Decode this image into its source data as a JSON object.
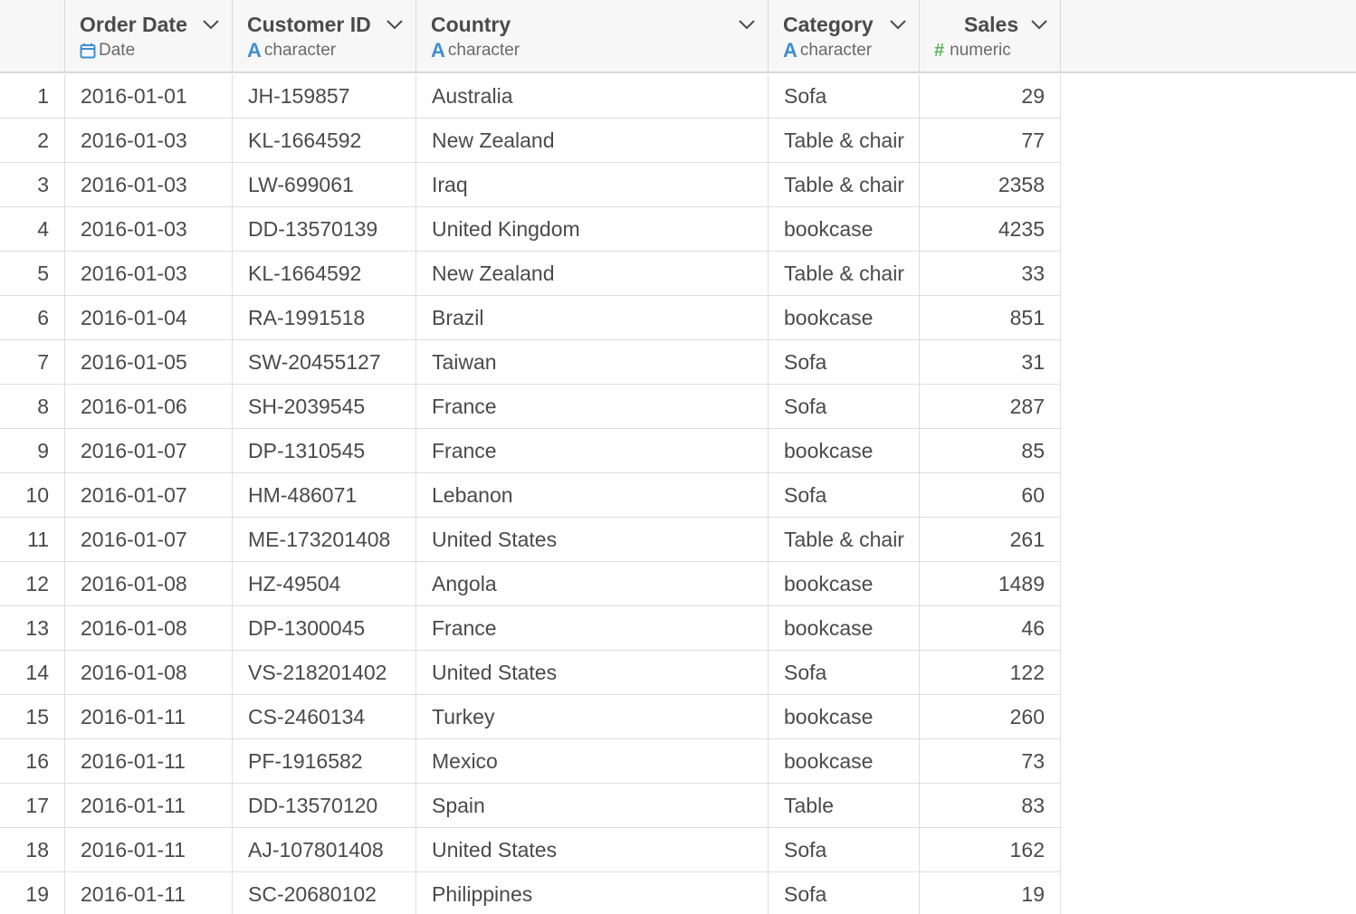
{
  "columns": [
    {
      "name": "Order Date",
      "type_label": "Date",
      "type_icon": "calendar-icon"
    },
    {
      "name": "Customer ID",
      "type_label": "character",
      "type_icon": "character-type-icon",
      "type_glyph": "A"
    },
    {
      "name": "Country",
      "type_label": "character",
      "type_icon": "character-type-icon",
      "type_glyph": "A"
    },
    {
      "name": "Category",
      "type_label": "character",
      "type_icon": "character-type-icon",
      "type_glyph": "A"
    },
    {
      "name": "Sales",
      "type_label": "numeric",
      "type_icon": "numeric-type-icon",
      "type_glyph": "#"
    }
  ],
  "colors": {
    "header_bg": "#f7f7f7",
    "grid_line": "#dedede",
    "text": "#4a4a4a",
    "character_icon": "#3d8fd1",
    "numeric_icon": "#5fb35f",
    "date_icon": "#3d8fd1"
  },
  "rows": [
    {
      "n": "1",
      "order_date": "2016-01-01",
      "customer_id": "JH-159857",
      "country": "Australia",
      "category": "Sofa",
      "sales": "29"
    },
    {
      "n": "2",
      "order_date": "2016-01-03",
      "customer_id": "KL-1664592",
      "country": "New Zealand",
      "category": "Table & chair",
      "sales": "77"
    },
    {
      "n": "3",
      "order_date": "2016-01-03",
      "customer_id": "LW-699061",
      "country": "Iraq",
      "category": "Table & chair",
      "sales": "2358"
    },
    {
      "n": "4",
      "order_date": "2016-01-03",
      "customer_id": "DD-13570139",
      "country": "United Kingdom",
      "category": "bookcase",
      "sales": "4235"
    },
    {
      "n": "5",
      "order_date": "2016-01-03",
      "customer_id": "KL-1664592",
      "country": "New Zealand",
      "category": "Table & chair",
      "sales": "33"
    },
    {
      "n": "6",
      "order_date": "2016-01-04",
      "customer_id": "RA-1991518",
      "country": "Brazil",
      "category": "bookcase",
      "sales": "851"
    },
    {
      "n": "7",
      "order_date": "2016-01-05",
      "customer_id": "SW-20455127",
      "country": "Taiwan",
      "category": "Sofa",
      "sales": "31"
    },
    {
      "n": "8",
      "order_date": "2016-01-06",
      "customer_id": "SH-2039545",
      "country": "France",
      "category": "Sofa",
      "sales": "287"
    },
    {
      "n": "9",
      "order_date": "2016-01-07",
      "customer_id": "DP-1310545",
      "country": "France",
      "category": "bookcase",
      "sales": "85"
    },
    {
      "n": "10",
      "order_date": "2016-01-07",
      "customer_id": "HM-486071",
      "country": "Lebanon",
      "category": "Sofa",
      "sales": "60"
    },
    {
      "n": "11",
      "order_date": "2016-01-07",
      "customer_id": "ME-173201408",
      "country": "United States",
      "category": "Table & chair",
      "sales": "261"
    },
    {
      "n": "12",
      "order_date": "2016-01-08",
      "customer_id": "HZ-49504",
      "country": "Angola",
      "category": "bookcase",
      "sales": "1489"
    },
    {
      "n": "13",
      "order_date": "2016-01-08",
      "customer_id": "DP-1300045",
      "country": "France",
      "category": "bookcase",
      "sales": "46"
    },
    {
      "n": "14",
      "order_date": "2016-01-08",
      "customer_id": "VS-218201402",
      "country": "United States",
      "category": "Sofa",
      "sales": "122"
    },
    {
      "n": "15",
      "order_date": "2016-01-11",
      "customer_id": "CS-2460134",
      "country": "Turkey",
      "category": "bookcase",
      "sales": "260"
    },
    {
      "n": "16",
      "order_date": "2016-01-11",
      "customer_id": "PF-1916582",
      "country": "Mexico",
      "category": "bookcase",
      "sales": "73"
    },
    {
      "n": "17",
      "order_date": "2016-01-11",
      "customer_id": "DD-13570120",
      "country": "Spain",
      "category": "Table",
      "sales": "83"
    },
    {
      "n": "18",
      "order_date": "2016-01-11",
      "customer_id": "AJ-107801408",
      "country": "United States",
      "category": "Sofa",
      "sales": "162"
    },
    {
      "n": "19",
      "order_date": "2016-01-11",
      "customer_id": "SC-20680102",
      "country": "Philippines",
      "category": "Sofa",
      "sales": "19"
    }
  ]
}
